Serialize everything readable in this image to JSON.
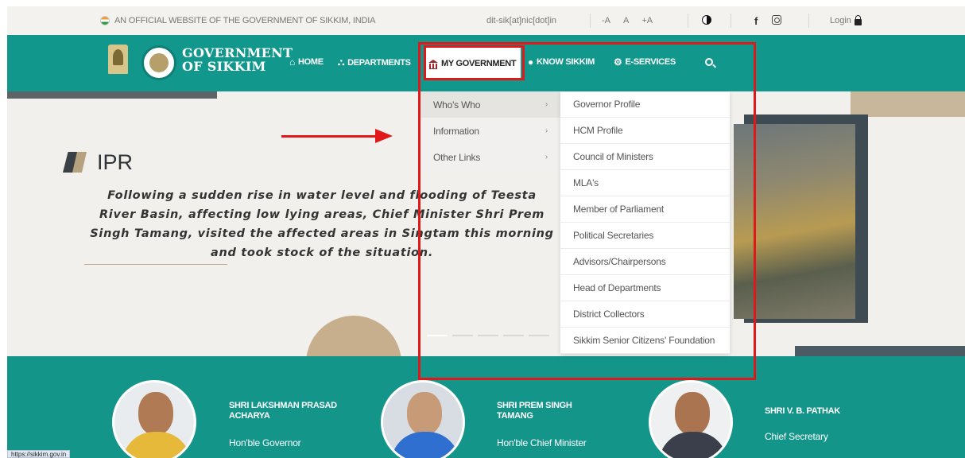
{
  "topbar": {
    "official_text": "AN OFFICIAL WEBSITE OF THE GOVERNMENT OF SIKKIM, INDIA",
    "email": "dit-sik[at]nic[dot]in",
    "font_decrease": "-A",
    "font_normal": "A",
    "font_increase": "+A",
    "facebook": "f",
    "login": "Login"
  },
  "header": {
    "brand_line1": "GOVERNMENT",
    "brand_line2": "OF SIKKIM",
    "nav": {
      "home": "HOME",
      "departments": "DEPARTMENTS",
      "my_government": "MY GOVERNMENT",
      "know_sikkim": "KNOW SIKKIM",
      "e_services": "E-SERVICES"
    }
  },
  "dropdown": {
    "primary": [
      {
        "label": "Who's Who",
        "chevron": "›"
      },
      {
        "label": "Information",
        "chevron": "›"
      },
      {
        "label": "Other Links",
        "chevron": "›"
      }
    ],
    "secondary": [
      "Governor Profile",
      "HCM Profile",
      "Council of Ministers",
      "MLA's",
      "Member of Parliament",
      "Political Secretaries",
      "Advisors/Chairpersons",
      "Head of Departments",
      "District Collectors",
      "Sikkim Senior Citizens' Foundation"
    ]
  },
  "hero": {
    "section": "IPR",
    "headline": "Following a sudden rise in water level and flooding of Teesta River Basin, affecting low lying areas, Chief Minister Shri Prem Singh Tamang, visited the affected areas in Singtam this morning and took stock of the situation."
  },
  "officials": [
    {
      "name": "SHRI LAKSHMAN PRASAD ACHARYA",
      "title": "Hon'ble Governor"
    },
    {
      "name": "SHRI PREM SINGH TAMANG",
      "title": "Hon'ble Chief Minister"
    },
    {
      "name": "SHRI V. B. PATHAK",
      "title": "Chief Secretary"
    }
  ],
  "status_url": "https://sikkim.gov.in",
  "colors": {
    "teal": "#12978c",
    "annotation_red": "#e0181a",
    "tan": "#c8b79b"
  }
}
